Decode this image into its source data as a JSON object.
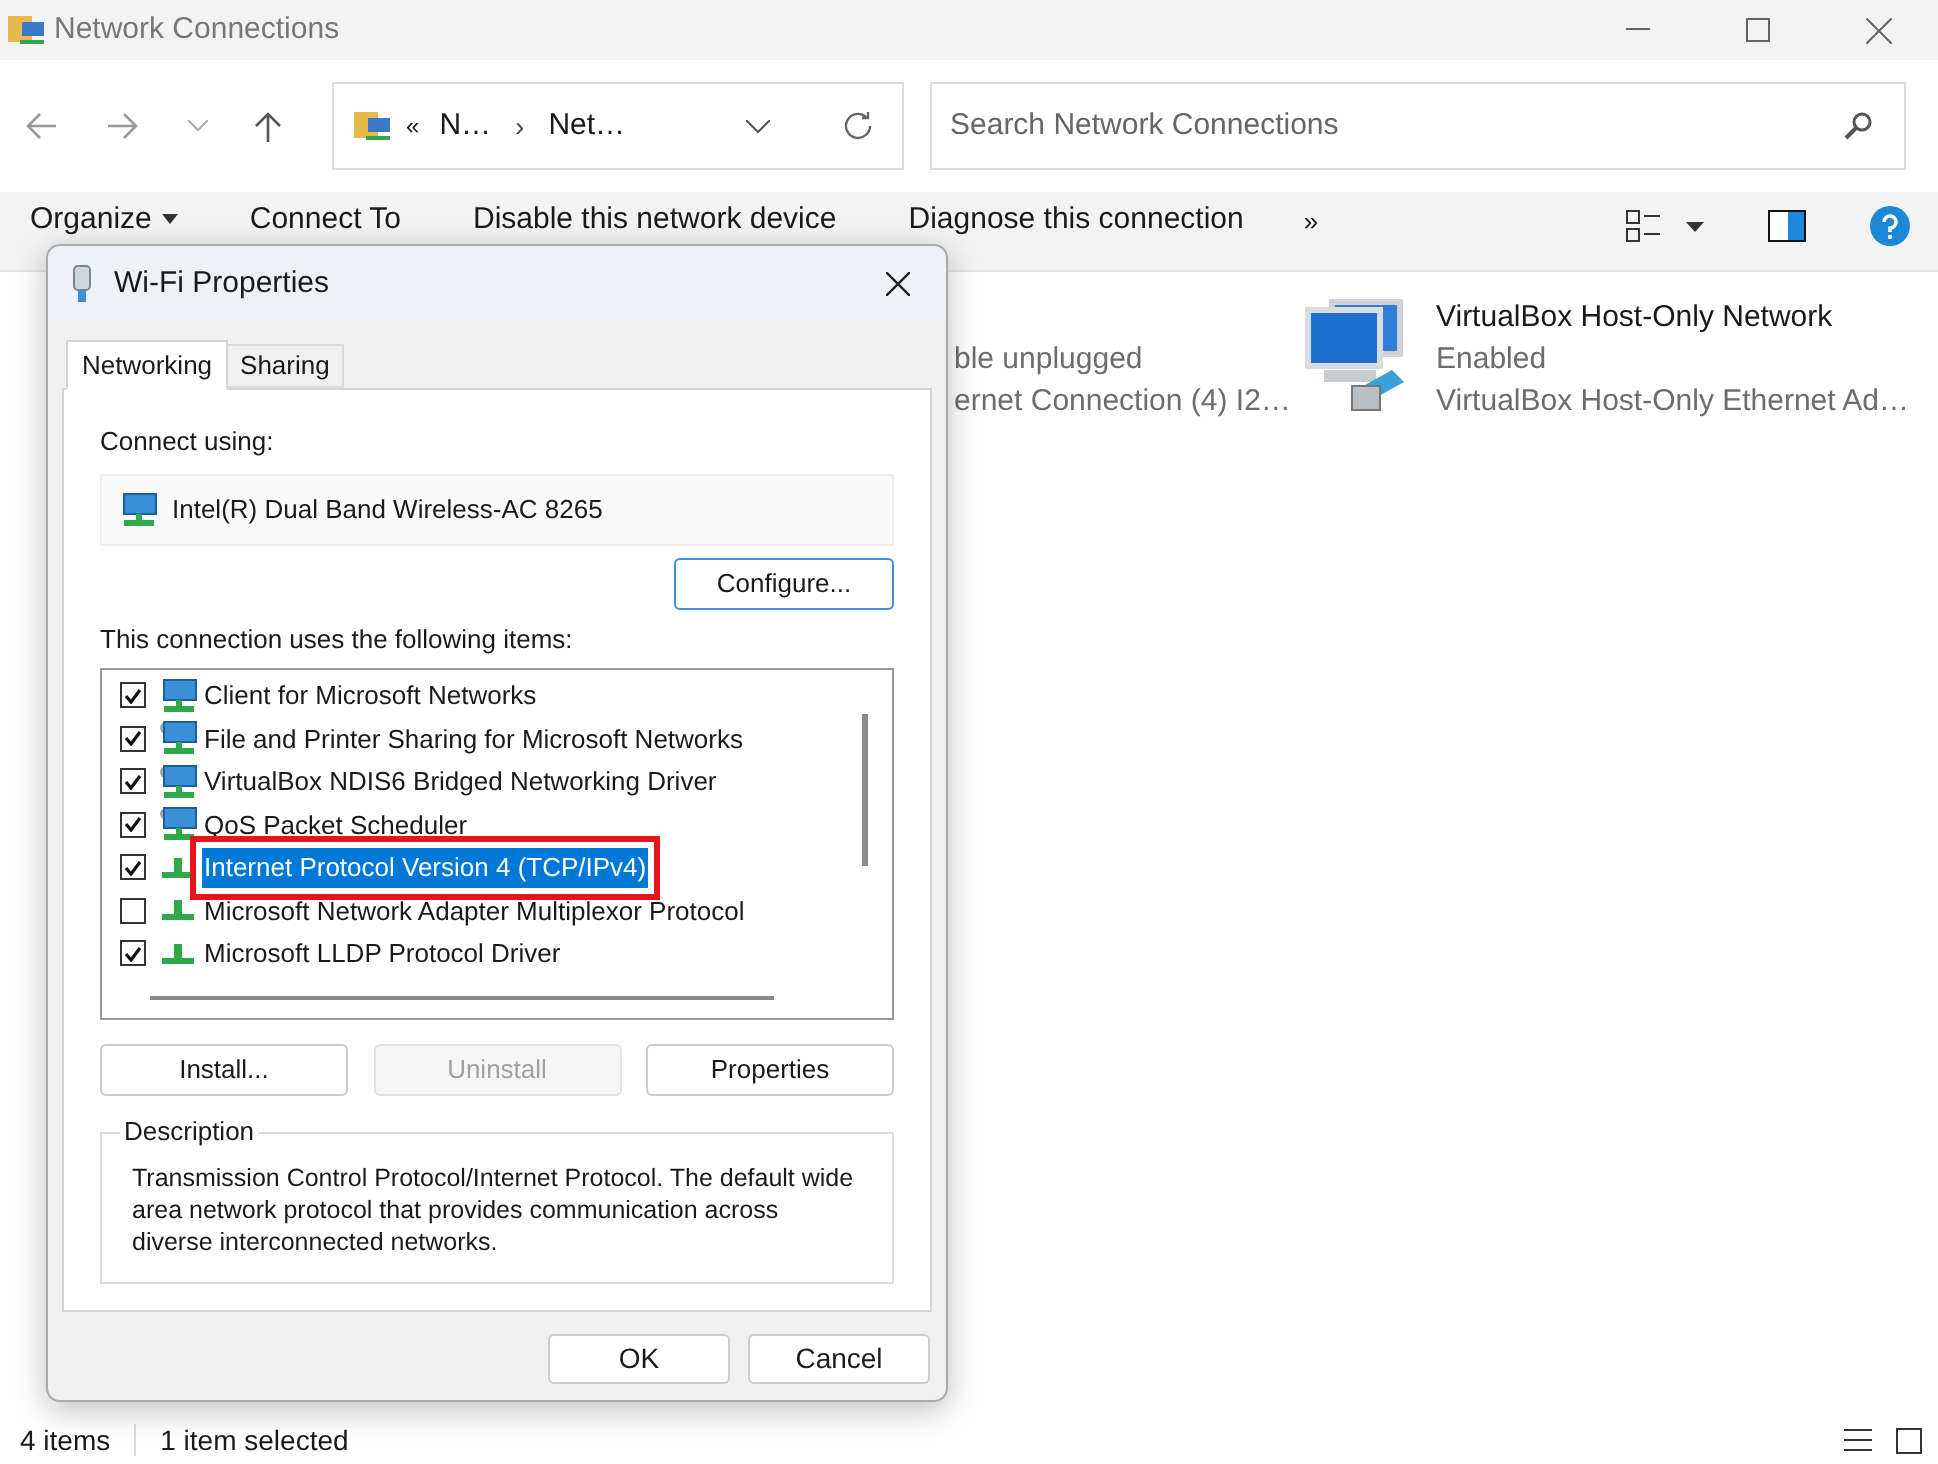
{
  "window": {
    "title": "Network Connections"
  },
  "address_bar": {
    "prefix": "«",
    "separator": "›",
    "items": [
      "N…",
      "Net…"
    ]
  },
  "search": {
    "placeholder": "Search Network Connections"
  },
  "toolbar": {
    "items": [
      {
        "label": "Organize",
        "kind": "menu"
      },
      {
        "label": "Connect To",
        "kind": "plain"
      },
      {
        "label": "Disable this network device",
        "kind": "plain"
      },
      {
        "label": "Diagnose this connection",
        "kind": "plain"
      }
    ],
    "overflow": "»"
  },
  "connections": [
    {
      "kind": "partial",
      "status": "ble unplugged",
      "device": "ernet Connection (4) I2…"
    },
    {
      "kind": "full",
      "name": "VirtualBox Host-Only Network",
      "status": "Enabled",
      "device": "VirtualBox Host-Only Ethernet Ad…"
    }
  ],
  "dialog": {
    "title": "Wi-Fi Properties",
    "tabs": [
      {
        "label": "Networking",
        "selected": true
      },
      {
        "label": "Sharing",
        "selected": false
      }
    ],
    "connect_using_label": "Connect using:",
    "adapter": "Intel(R) Dual Band Wireless-AC 8265",
    "configure_button": "Configure...",
    "items_label": "This connection uses the following items:",
    "items": [
      {
        "label": "Client for Microsoft Networks",
        "kind": "client",
        "checked": true,
        "selected": false,
        "highlighted": false
      },
      {
        "label": "File and Printer Sharing for Microsoft Networks",
        "kind": "service",
        "checked": true,
        "selected": false,
        "highlighted": false
      },
      {
        "label": "VirtualBox NDIS6 Bridged Networking Driver",
        "kind": "service",
        "checked": true,
        "selected": false,
        "highlighted": false
      },
      {
        "label": "QoS Packet Scheduler",
        "kind": "service",
        "checked": true,
        "selected": false,
        "highlighted": false
      },
      {
        "label": "Internet Protocol Version 4 (TCP/IPv4)",
        "kind": "protocol",
        "checked": true,
        "selected": true,
        "highlighted": true
      },
      {
        "label": "Microsoft Network Adapter Multiplexor Protocol",
        "kind": "protocol",
        "checked": false,
        "selected": false,
        "highlighted": false
      },
      {
        "label": "Microsoft LLDP Protocol Driver",
        "kind": "protocol",
        "checked": true,
        "selected": false,
        "highlighted": false
      }
    ],
    "buttons": [
      {
        "label": "Install...",
        "disabled": false
      },
      {
        "label": "Uninstall",
        "disabled": true
      },
      {
        "label": "Properties",
        "disabled": false
      }
    ],
    "description_title": "Description",
    "description": "Transmission Control Protocol/Internet Protocol. The default wide area network protocol that provides communication across diverse interconnected networks.",
    "footer_buttons": [
      "OK",
      "Cancel"
    ]
  },
  "status_bar": {
    "item_count": "4 items",
    "selection": "1 item selected"
  }
}
